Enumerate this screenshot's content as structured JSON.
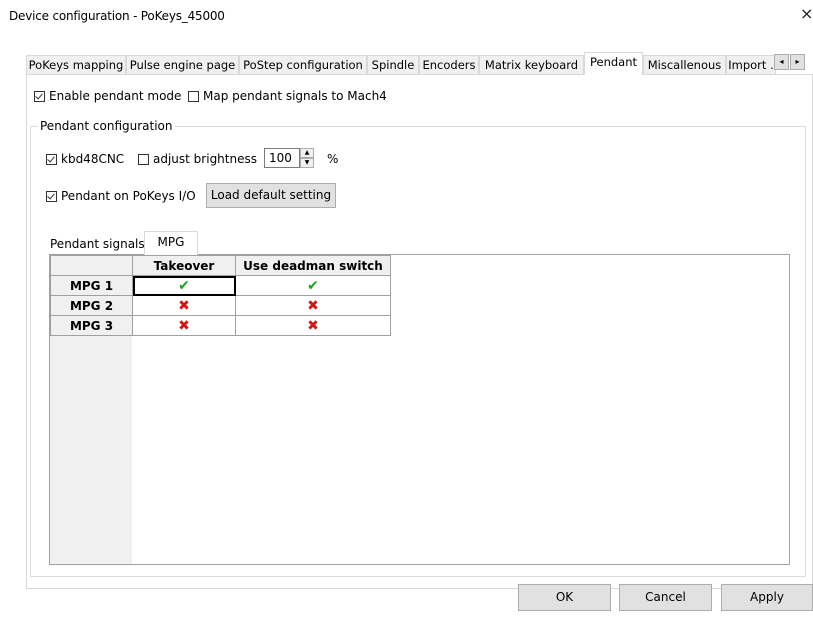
{
  "window": {
    "title": "Device configuration - PoKeys_45000",
    "close_glyph": "×"
  },
  "tabs": [
    {
      "label": "PoKeys mapping"
    },
    {
      "label": "Pulse engine page"
    },
    {
      "label": "PoStep configuration"
    },
    {
      "label": "Spindle"
    },
    {
      "label": "Encoders"
    },
    {
      "label": "Matrix keyboard"
    },
    {
      "label": "Pendant"
    },
    {
      "label": "Miscallenous"
    },
    {
      "label": "Import ."
    }
  ],
  "active_tab": "Pendant",
  "tab_scroll": {
    "left": "◂",
    "right": "▸"
  },
  "pendant": {
    "enable_mode": {
      "label": "Enable pendant mode",
      "checked": true
    },
    "map_signals": {
      "label": "Map pendant signals to Mach4",
      "checked": false
    },
    "group_label": "Pendant configuration",
    "kbd48cnc": {
      "label": "kbd48CNC",
      "checked": true
    },
    "adjust_brightness": {
      "label": "adjust brightness",
      "checked": false
    },
    "brightness_value": "100",
    "brightness_unit": "%",
    "pendant_on_io": {
      "label": "Pendant on PoKeys I/O",
      "checked": true
    },
    "load_default_label": "Load default setting"
  },
  "inner_tabs": [
    {
      "label": "Pendant signals"
    },
    {
      "label": "MPG"
    }
  ],
  "inner_active_tab": "MPG",
  "mpg_grid": {
    "columns": [
      "Takeover",
      "Use deadman switch"
    ],
    "rows": [
      {
        "label": "MPG 1",
        "takeover": true,
        "deadman": true
      },
      {
        "label": "MPG 2",
        "takeover": false,
        "deadman": false
      },
      {
        "label": "MPG 3",
        "takeover": false,
        "deadman": false
      }
    ],
    "check_glyph": "✔",
    "cross_glyph": "✖"
  },
  "footer": {
    "ok": "OK",
    "cancel": "Cancel",
    "apply": "Apply"
  },
  "colors": {
    "check": "#1fa31f",
    "cross": "#d01818",
    "tab_bg": "#f0f0f0",
    "button_bg": "#e1e1e1"
  }
}
